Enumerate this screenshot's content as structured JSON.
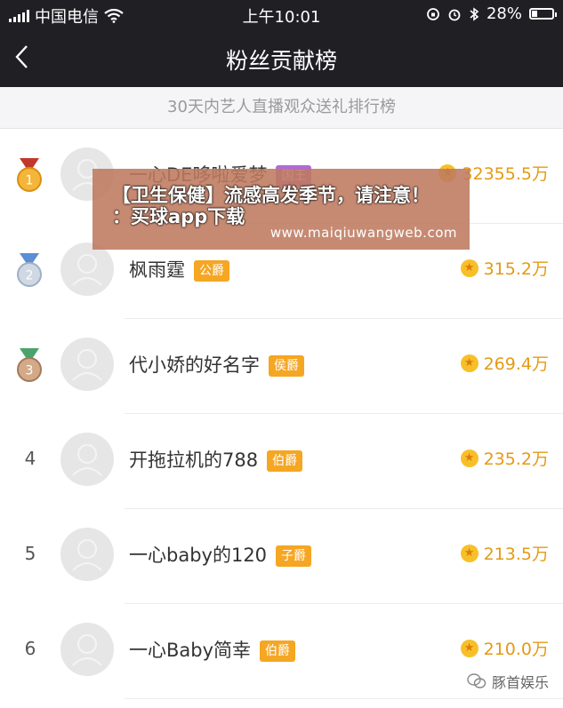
{
  "status_bar": {
    "carrier": "中国电信",
    "time": "上午10:01",
    "battery": "28%",
    "battery_level": 0.28
  },
  "nav": {
    "title": "粉丝贡献榜"
  },
  "subtitle": "30天内艺人直播观众送礼排行榜",
  "rows": [
    {
      "rank": "1",
      "name": "一心DE哆啦爱梦",
      "badge": "国王",
      "score": "32355.5万",
      "medal": "gold"
    },
    {
      "rank": "2",
      "name": "枫雨霆",
      "badge": "公爵",
      "score": "315.2万",
      "medal": "silver"
    },
    {
      "rank": "3",
      "name": "代小娇的好名字",
      "badge": "侯爵",
      "score": "269.4万",
      "medal": "bronze"
    },
    {
      "rank": "4",
      "name": "开拖拉机的788",
      "badge": "伯爵",
      "score": "235.2万"
    },
    {
      "rank": "5",
      "name": "一心baby的120",
      "badge": "子爵",
      "score": "213.5万"
    },
    {
      "rank": "6",
      "name": "一心Baby简幸",
      "badge": "伯爵",
      "score": "210.0万"
    }
  ],
  "overlay": {
    "line1": "【卫生保健】流感高发季节，请注意！",
    "line2": "：买球app下载",
    "url": "www.maiqiuwangweb.com"
  },
  "watermark": "豚首娱乐",
  "colors": {
    "header_bg": "#1f1f24",
    "accent": "#f5a623",
    "score": "#e49a14"
  }
}
